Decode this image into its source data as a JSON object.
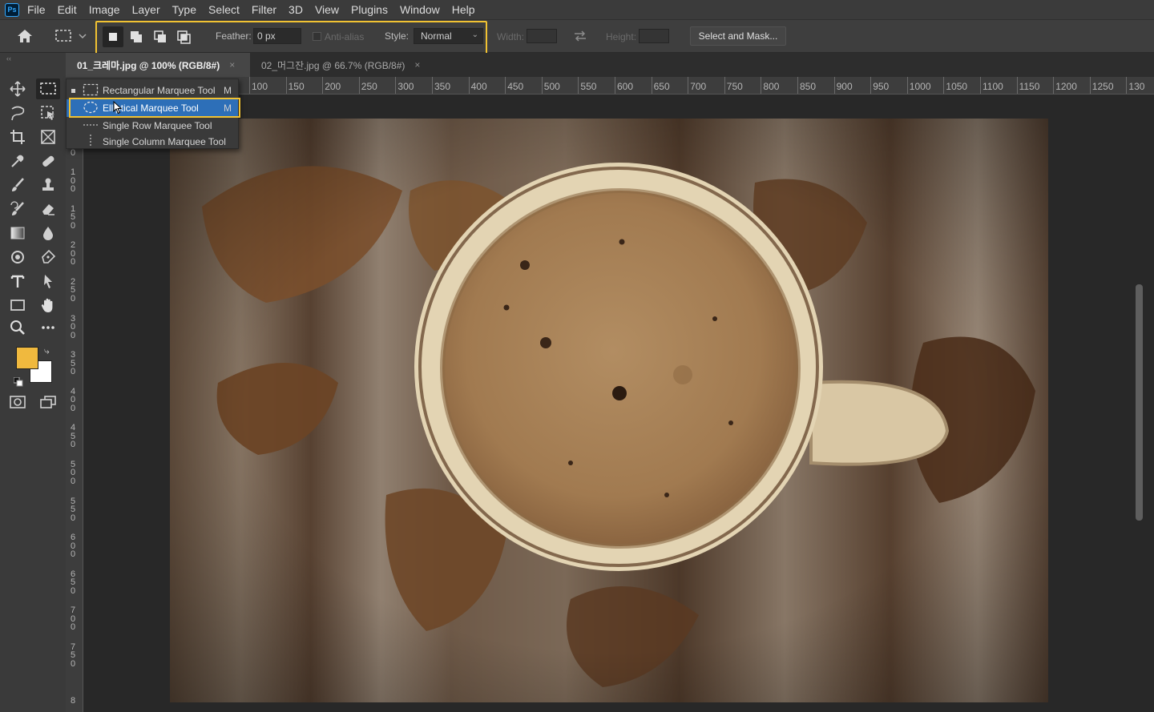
{
  "app": {
    "logo_text": "Ps",
    "menu": [
      "File",
      "Edit",
      "Image",
      "Layer",
      "Type",
      "Select",
      "Filter",
      "3D",
      "View",
      "Plugins",
      "Window",
      "Help"
    ]
  },
  "options": {
    "feather_label": "Feather:",
    "feather_value": "0 px",
    "antialias_label": "Anti-alias",
    "style_label": "Style:",
    "style_value": "Normal",
    "width_label": "Width:",
    "height_label": "Height:",
    "select_mask_label": "Select and Mask..."
  },
  "tabs": [
    {
      "label": "01_크레마.jpg @ 100% (RGB/8#)",
      "close": "×"
    },
    {
      "label": "02_머그잔.jpg @ 66.7% (RGB/8#)",
      "close": "×"
    }
  ],
  "flyout": {
    "items": [
      {
        "label": "Rectangular Marquee Tool",
        "shortcut": "M",
        "icon": "rect-marquee-icon"
      },
      {
        "label": "Elliptical Marquee Tool",
        "shortcut": "M",
        "icon": "ellipse-marquee-icon"
      },
      {
        "label": "Single Row Marquee Tool",
        "shortcut": "",
        "icon": "single-row-icon"
      },
      {
        "label": "Single Column Marquee Tool",
        "shortcut": "",
        "icon": "single-column-icon"
      }
    ]
  },
  "ruler": {
    "top": [
      "100",
      "150",
      "200",
      "250",
      "300",
      "350",
      "400",
      "450",
      "500",
      "550",
      "600",
      "650",
      "700",
      "750",
      "800",
      "850",
      "900",
      "950",
      "1000",
      "1050",
      "1100",
      "1150",
      "1200",
      "1250",
      "130"
    ],
    "left": [
      "50",
      "100",
      "150",
      "200",
      "250",
      "300",
      "350",
      "400",
      "450",
      "500",
      "550",
      "600",
      "650",
      "700",
      "750",
      "8"
    ]
  },
  "colors": {
    "foreground": "#f0b93e",
    "background": "#ffffff",
    "highlight": "#f1c232"
  }
}
